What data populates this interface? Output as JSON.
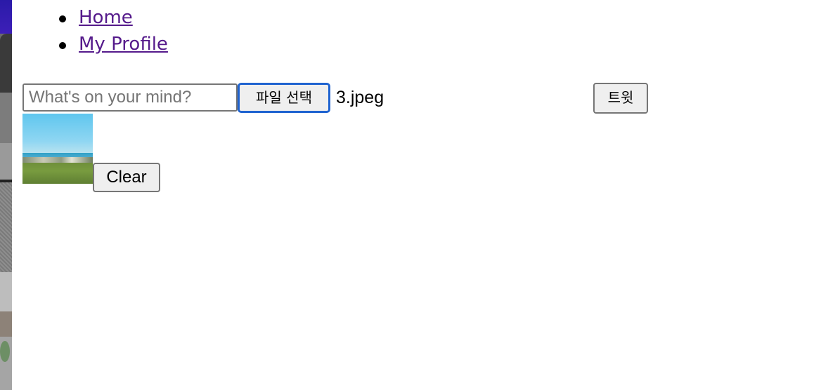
{
  "nav": {
    "items": [
      {
        "label": "Home"
      },
      {
        "label": "My Profile"
      }
    ]
  },
  "tweet_form": {
    "input": {
      "value": "",
      "placeholder": "What's on your mind?"
    },
    "file_button_label": "파일 선택",
    "file_name": "3.jpeg",
    "submit_label": "트윗"
  },
  "attachment": {
    "clear_label": "Clear"
  },
  "colors": {
    "link": "#551a8b",
    "focus_ring": "#1f63d0",
    "button_bg": "#efefef",
    "button_border": "#767676"
  }
}
